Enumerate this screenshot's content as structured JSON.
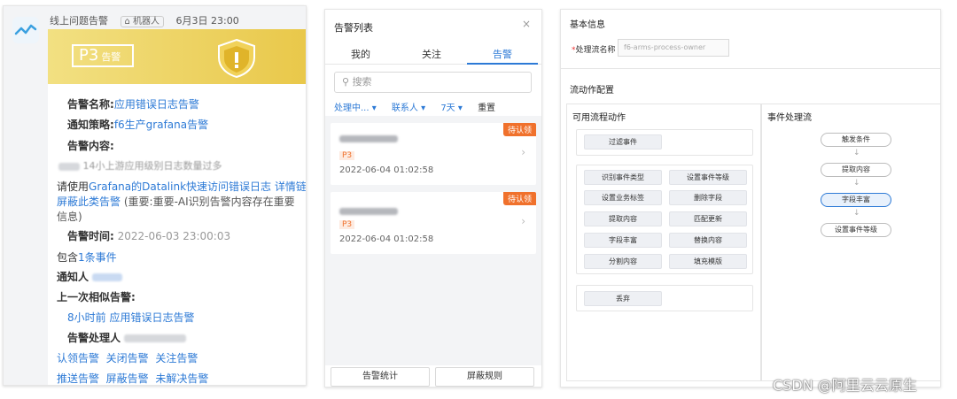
{
  "chat": {
    "group_name": "线上问题告警",
    "sender_tag": "机器人",
    "date": "6月3日 23:00",
    "badge": {
      "level": "P3",
      "suffix": "告警"
    },
    "name_label": "告警名称:",
    "name_value": "应用错误日志告警",
    "policy_label": "通知策略:",
    "policy_value": "f6生产grafana告警",
    "content_label": "告警内容:",
    "content_value": "14小上游应用级别日志数量过多",
    "hint_prefix": "请使用",
    "hint_link": "Grafana的Datalink快速访问错误日志",
    "hint_detail": "详情链接",
    "hint_shield": "屏蔽此类告警",
    "hint_note": "(重要:重要-AI识别告警内容存在重要",
    "hint_note2": "信息)",
    "time_label": "告警时间:",
    "time_value": "2022-06-03 23:00:03",
    "events_prefix": "包含",
    "events_link": "1条事件",
    "notify_label": "通知人",
    "prev_label": "上一次相似告警:",
    "prev_value": "8小时前 应用错误日志告警",
    "handler_label": "告警处理人",
    "actions_row1": [
      "认领告警",
      "关闭告警",
      "关注告警"
    ],
    "actions_row2": [
      "推送告警",
      "屏蔽告警",
      "未解决告警"
    ],
    "accent": "#2d7ad6"
  },
  "alert_list": {
    "title": "告警列表",
    "close_icon": "×",
    "tabs": [
      "我的",
      "关注",
      "告警"
    ],
    "active_tab": "告警",
    "search_placeholder": "搜索",
    "filters": [
      "处理中... ▾",
      "联系人 ▾",
      "7天 ▾"
    ],
    "reset": "重置",
    "items": [
      {
        "tag": "待认领",
        "level": "P3",
        "time": "2022-06-04 01:02:58"
      },
      {
        "tag": "待认领",
        "level": "P3",
        "time": "2022-06-04 01:02:58"
      }
    ],
    "footer": [
      "告警统计",
      "屏蔽规则"
    ],
    "tag_color": "#f0712c"
  },
  "config": {
    "basic_title": "基本信息",
    "field_label": "处理流名称",
    "field_value": "f6-arms-process-owner",
    "flow_title": "流动作配置",
    "left_title": "可用流程动作",
    "right_title": "事件处理流",
    "filter_chip": "过滤事件",
    "chips": [
      "识别事件类型",
      "设置事件等级",
      "设置业务标签",
      "删除字段",
      "提取内容",
      "匹配更新",
      "字段丰富",
      "替换内容",
      "分割内容",
      "填充模版"
    ],
    "discard_chip": "丢弃",
    "flow_nodes": [
      "触发条件",
      "提取内容",
      "字段丰富",
      "设置事件等级"
    ],
    "selected_node": "字段丰富"
  },
  "watermark": "CSDN @阿里云云原生"
}
